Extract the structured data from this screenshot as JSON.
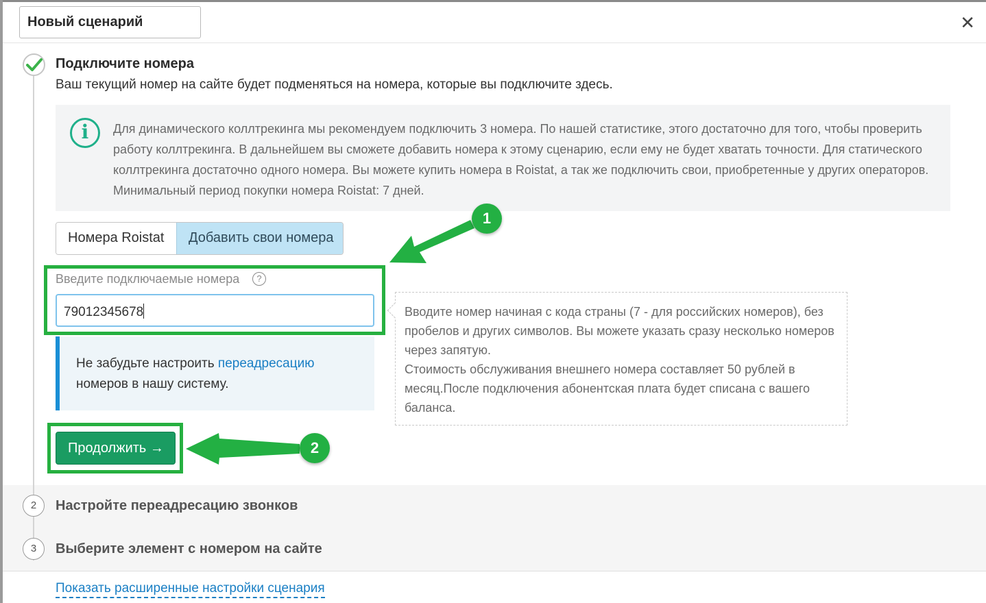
{
  "header": {
    "scenario_name": "Новый сценарий",
    "close_icon": "close-icon"
  },
  "step1": {
    "title": "Подключите номера",
    "subtitle": "Ваш текущий номер на сайте будет подменяться на номера, которые вы подключите здесь.",
    "status_icon": "check-icon",
    "info_icon": "info-icon",
    "info_text": "Для динамического коллтрекинга мы рекомендуем подключить 3 номера. По нашей статистике, этого достаточно для того, чтобы проверить работу коллтрекинга. В дальнейшем вы сможете добавить номера к этому сценарию, если ему не будет хватать точности. Для статического коллтрекинга достаточно одного номера. Вы можете купить номера в Roistat, а так же подключить свои, приобретенные у других операторов. Минимальный период покупки номера Roistat: 7 дней.",
    "tabs": [
      {
        "label": "Номера Roistat",
        "active": false
      },
      {
        "label": "Добавить свои номера",
        "active": true
      }
    ],
    "field_label": "Введите подключаемые номера",
    "help_icon": "?",
    "phone_value": "79012345678",
    "notice_prefix": "Не забудьте настроить ",
    "notice_link": "переадресацию",
    "notice_suffix": " номеров в нашу систему.",
    "tooltip_line1": "Вводите номер начиная с кода страны (7 - для российских номеров), без пробелов и других символов. Вы можете указать сразу несколько номеров через запятую.",
    "tooltip_line2": "Стоимость обслуживания внешнего номера составляет 50 рублей в месяц.После подключения абонентская плата будет списана с вашего баланса.",
    "continue_label": "Продолжить →"
  },
  "callouts": [
    "1",
    "2"
  ],
  "steps": [
    {
      "number": "2",
      "title": "Настройте переадресацию звонков"
    },
    {
      "number": "3",
      "title": "Выберите элемент с номером на сайте"
    }
  ],
  "advanced_link": "Показать расширенные настройки сценария",
  "colors": {
    "accent_green": "#1a9c62",
    "highlight_green": "#26b040",
    "link_blue": "#1a7fc4",
    "active_tab": "#bfe3f5",
    "info_teal": "#1fb08a"
  }
}
